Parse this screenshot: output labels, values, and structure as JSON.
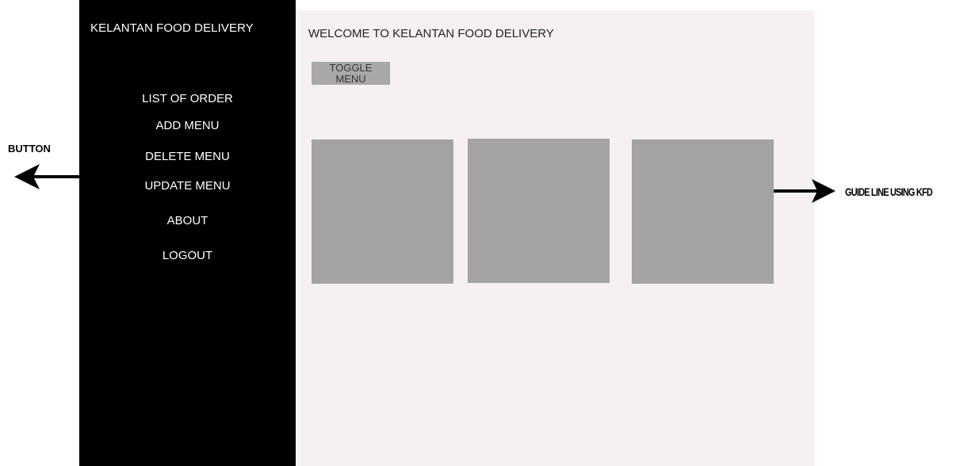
{
  "sidebar": {
    "brand": "KELANTAN FOOD DELIVERY",
    "items": [
      {
        "label": "LIST OF ORDER"
      },
      {
        "label": "ADD MENU"
      },
      {
        "label": "DELETE MENU"
      },
      {
        "label": "UPDATE MENU"
      },
      {
        "label": "ABOUT"
      },
      {
        "label": "LOGOUT"
      }
    ]
  },
  "main": {
    "welcome": "WELCOME TO KELANTAN FOOD DELIVERY",
    "toggle_line1": "TOGGLE",
    "toggle_line2": "MENU",
    "card_color": "#a3a3a3"
  },
  "annotations": {
    "left_label": "BUTTON",
    "right_label": "GUIDE LINE USING KFD"
  },
  "colors": {
    "sidebar_bg": "#000000",
    "main_bg": "#f7f0f0",
    "toggle_bg": "#a8a8a8"
  }
}
